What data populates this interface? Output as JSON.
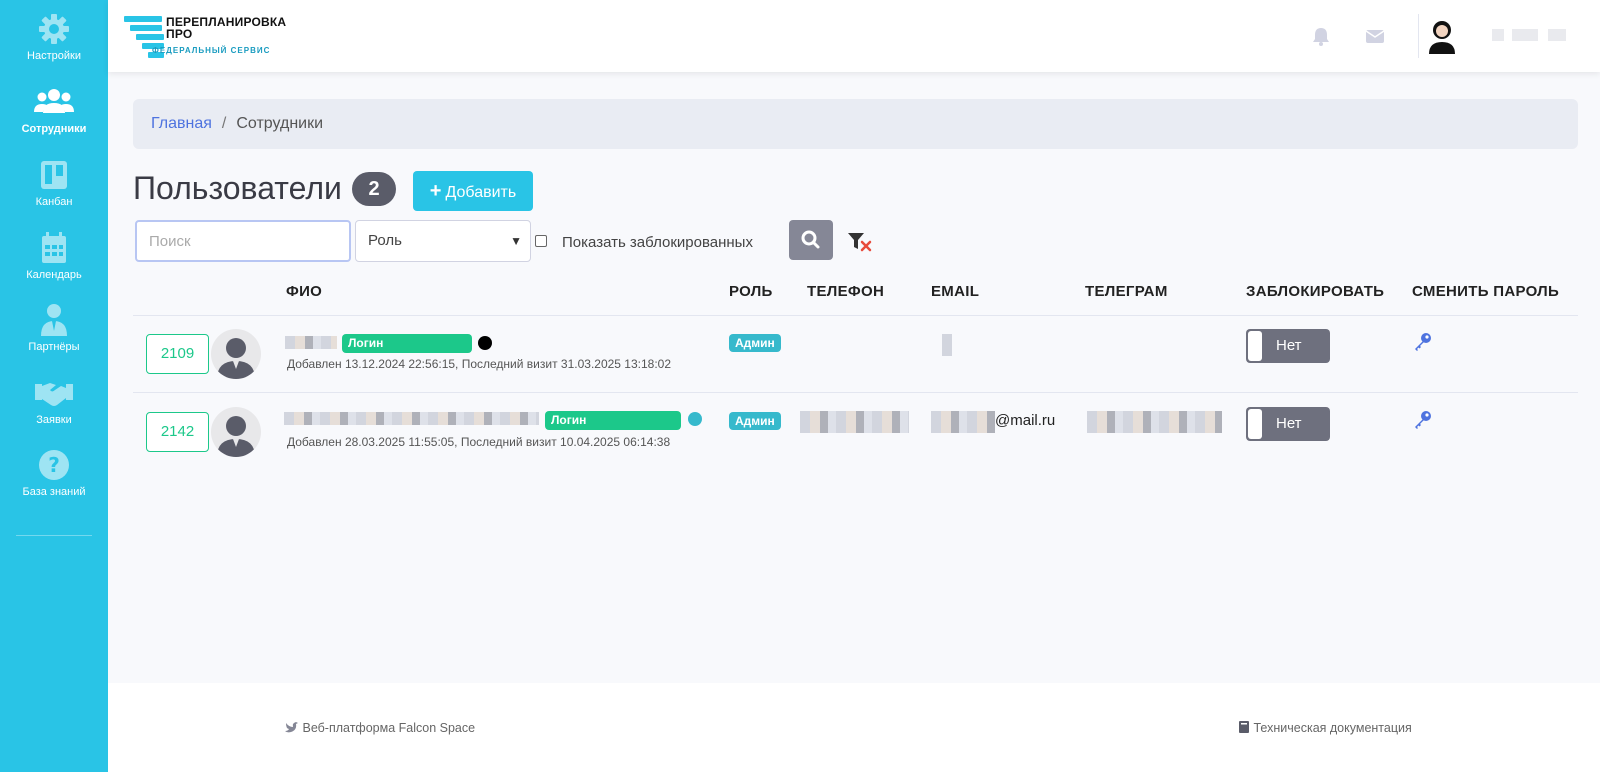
{
  "sidebar": {
    "items": [
      {
        "label": "Настройки",
        "icon": "gear-icon"
      },
      {
        "label": "Сотрудники",
        "icon": "users-icon",
        "active": true
      },
      {
        "label": "Канбан",
        "icon": "kanban-icon"
      },
      {
        "label": "Календарь",
        "icon": "calendar-icon"
      },
      {
        "label": "Партнёры",
        "icon": "partner-icon"
      },
      {
        "label": "Заявки",
        "icon": "handshake-icon"
      },
      {
        "label": "База знаний",
        "icon": "question-icon"
      }
    ]
  },
  "header": {
    "logo_title_line1": "ПЕРЕПЛАНИРОВКА",
    "logo_title_line2": "ПРО",
    "logo_subtitle": "ФЕДЕРАЛЬНЫЙ СЕРВИС",
    "icons": [
      "bell-icon",
      "envelope-icon"
    ]
  },
  "breadcrumb": {
    "home": "Главная",
    "separator": "/",
    "current": "Сотрудники"
  },
  "page": {
    "title": "Пользователи",
    "count": "2",
    "add_label": "Добавить"
  },
  "filters": {
    "search_placeholder": "Поиск",
    "role_selected": "Роль",
    "show_blocked_label": "Показать заблокированных"
  },
  "table": {
    "headers": {
      "name": "ФИО",
      "role": "РОЛЬ",
      "phone": "ТЕЛЕФОН",
      "email": "EMAIL",
      "telegram": "ТЕЛЕГРАМ",
      "block": "ЗАБЛОКИРОВАТЬ",
      "password": "СМЕНИТЬ ПАРОЛЬ"
    },
    "rows": [
      {
        "id": "2109",
        "login_label": "Логин",
        "meta": "Добавлен 13.12.2024 22:56:15, Последний визит 31.03.2025 13:18:02",
        "role": "Админ",
        "email_suffix": "",
        "block_label": "Нет",
        "status_color": "#000000"
      },
      {
        "id": "2142",
        "login_label": "Логин",
        "meta": "Добавлен 28.03.2025 11:55:05, Последний визит 10.04.2025 06:14:38",
        "role": "Админ",
        "email_suffix": "@mail.ru",
        "block_label": "Нет",
        "status_color": "#36b9cc"
      }
    ]
  },
  "footer": {
    "left": "Веб-платформа Falcon Space",
    "right": "Техническая документация"
  },
  "colors": {
    "sidebar": "#29c4e6",
    "accent": "#29c4e6",
    "success": "#1cc88a",
    "info": "#36b9cc",
    "link": "#4e73df"
  }
}
